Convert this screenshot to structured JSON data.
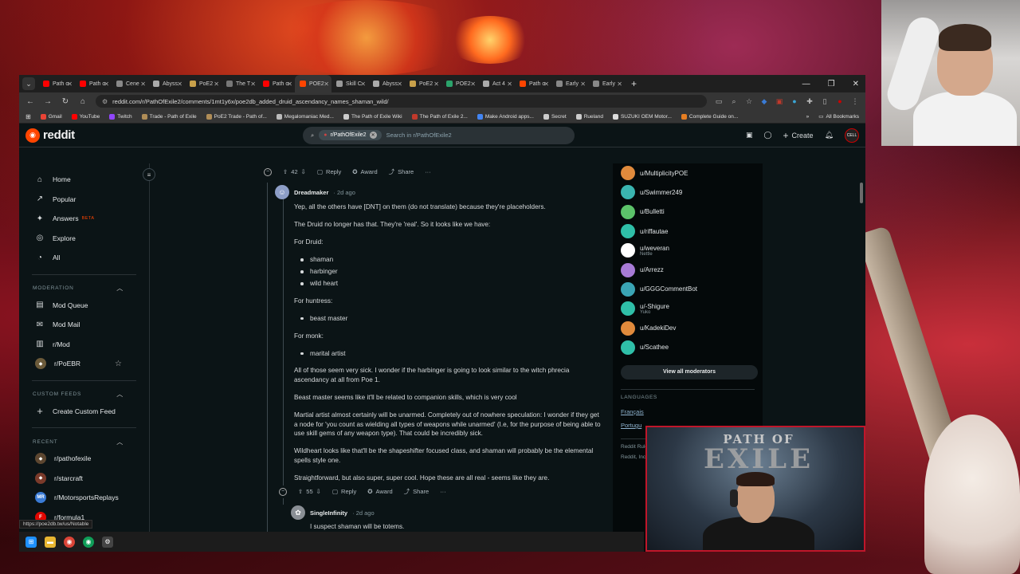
{
  "tabs": [
    {
      "label": "Path o",
      "color": "#ff0000"
    },
    {
      "label": "Path o",
      "color": "#ff0000"
    },
    {
      "label": "Cene",
      "color": "#888888"
    },
    {
      "label": "Abyss",
      "color": "#aaaaaa"
    },
    {
      "label": "PoE2",
      "color": "#c8a04a"
    },
    {
      "label": "The T",
      "color": "#777777"
    },
    {
      "label": "Path o",
      "color": "#ff0000"
    },
    {
      "label": "POE2",
      "color": "#ff4500",
      "active": true
    },
    {
      "label": "Skill C",
      "color": "#999999"
    },
    {
      "label": "Abyss",
      "color": "#aaaaaa"
    },
    {
      "label": "PoE2",
      "color": "#c8a04a"
    },
    {
      "label": "POE2",
      "color": "#2ba36b"
    },
    {
      "label": "Act 4",
      "color": "#aaaaaa"
    },
    {
      "label": "Path o",
      "color": "#ff4500"
    },
    {
      "label": "Early",
      "color": "#888888"
    },
    {
      "label": "Early",
      "color": "#888888"
    }
  ],
  "address": {
    "url": "reddit.com/r/PathOfExile2/comments/1mt1y6x/poe2db_added_druid_ascendancy_names_shaman_wild/"
  },
  "bookmarks": [
    {
      "label": "Gmail",
      "color": "#ea4335"
    },
    {
      "label": "YouTube",
      "color": "#ff0000"
    },
    {
      "label": "Twitch",
      "color": "#9146ff"
    },
    {
      "label": "Trade - Path of Exile",
      "color": "#b08d57"
    },
    {
      "label": "PoE2 Trade - Path of...",
      "color": "#b08d57"
    },
    {
      "label": "Megalomaniac Med...",
      "color": "#bbbbbb"
    },
    {
      "label": "The Path of Exile Wiki",
      "color": "#cccccc"
    },
    {
      "label": "The Path of Exile 2...",
      "color": "#c0392b"
    },
    {
      "label": "Make Android apps...",
      "color": "#4285f4"
    },
    {
      "label": "Secret",
      "color": "#cccccc"
    },
    {
      "label": "Rueland",
      "color": "#cccccc"
    },
    {
      "label": "SUZUKI OEM Motor...",
      "color": "#dddddd"
    },
    {
      "label": "Complete Guide on...",
      "color": "#e67e22"
    }
  ],
  "bookmarks_all": "All Bookmarks",
  "header": {
    "logo": "reddit",
    "search_chip": "r/PathOfExile2",
    "search_placeholder": "Search in r/PathOfExile2",
    "create": "Create",
    "avatar": "CELL"
  },
  "sidebar": {
    "main": [
      {
        "label": "Home",
        "icon": "home-icon"
      },
      {
        "label": "Popular",
        "icon": "popular-icon"
      },
      {
        "label": "Answers",
        "icon": "answers-icon",
        "badge": "BETA"
      },
      {
        "label": "Explore",
        "icon": "explore-icon"
      },
      {
        "label": "All",
        "icon": "all-icon"
      }
    ],
    "moderation_title": "MODERATION",
    "moderation": [
      {
        "label": "Mod Queue"
      },
      {
        "label": "Mod Mail"
      },
      {
        "label": "r/Mod"
      },
      {
        "label": "r/PoEBR"
      }
    ],
    "custom_title": "CUSTOM FEEDS",
    "custom": [
      {
        "label": "Create Custom Feed"
      }
    ],
    "recent_title": "RECENT",
    "recent": [
      {
        "label": "r/pathofexile",
        "color": "#5c4630"
      },
      {
        "label": "r/starcraft",
        "color": "#7a3a2a"
      },
      {
        "label": "r/MotorsportsReplays",
        "color": "#3a7bd5",
        "initials": "MR"
      },
      {
        "label": "r/formula1",
        "color": "#e10600"
      }
    ]
  },
  "thread": {
    "parent_actions": {
      "votes": "42",
      "reply": "Reply",
      "award": "Award",
      "share": "Share",
      "more": "···"
    },
    "comment": {
      "author": "Dreadmaker",
      "time": "2d ago",
      "paragraphs": {
        "p1": "Yep, all the others have [DNT] on them (do not translate) because they're placeholders.",
        "p2": "The Druid no longer has that. They're 'real'. So it looks like we have:",
        "druid_head": "For Druid:",
        "druid_1": "shaman",
        "druid_2": "harbinger",
        "druid_3": "wild heart",
        "huntress_head": "For huntress:",
        "huntress_1": "beast master",
        "monk_head": "For monk:",
        "monk_1": "marital artist",
        "p3": "All of those seem very sick. I wonder if the harbinger is going to look similar to the witch phrecia ascendancy at all from Poe 1.",
        "p4": "Beast master seems like it'll be related to companion skills, which is very cool",
        "p5": "Martial artist almost certainly will be unarmed. Completely out of nowhere speculation: I wonder if they get a node for 'you count as wielding all types of weapons while unarmed' (I.e, for the purpose of being able to use skill gems of any weapon type). That could be incredibly sick.",
        "p6": "Wildheart looks like that'll be the shapeshifter focused class, and shaman will probably be the elemental spells style one.",
        "p7": "Straightforward, but also super, super cool. Hope these are all real - seems like they are."
      },
      "actions": {
        "votes": "55",
        "reply": "Reply",
        "award": "Award",
        "share": "Share",
        "more": "···"
      }
    },
    "reply": {
      "author": "SingleInfinity",
      "time": "2d ago",
      "text": "I suspect shaman will be totems."
    }
  },
  "moderators": [
    {
      "name": "u/MultiplicityPOE",
      "color": "#e08a3c"
    },
    {
      "name": "u/Swimmer249",
      "color": "#3ab5b0"
    },
    {
      "name": "u/Bulletti",
      "color": "#5cc36a"
    },
    {
      "name": "u/riffautae",
      "color": "#2fbfa8"
    },
    {
      "name": "u/weveran",
      "color": "#ffffff",
      "flair": "Nettle"
    },
    {
      "name": "u/Arrezz",
      "color": "#a77bd6"
    },
    {
      "name": "u/GGGCommentBot",
      "color": "#3aa5b5"
    },
    {
      "name": "u/-Shigure",
      "color": "#2fbfa8",
      "flair": "Yuko"
    },
    {
      "name": "u/KadekiDev",
      "color": "#e08a3c"
    },
    {
      "name": "u/Scathee",
      "color": "#2fbfa8"
    }
  ],
  "view_all_mods": "View all moderators",
  "languages_title": "LANGUAGES",
  "languages": [
    "Français",
    "Portugu"
  ],
  "footer_lines": [
    "Reddit Rules",
    "Reddit, Inc. ©"
  ],
  "status_url": "https://poe2db.tw/us/Notable",
  "stream": {
    "banner_small": "PATH OF",
    "banner_big": "EXILE"
  }
}
